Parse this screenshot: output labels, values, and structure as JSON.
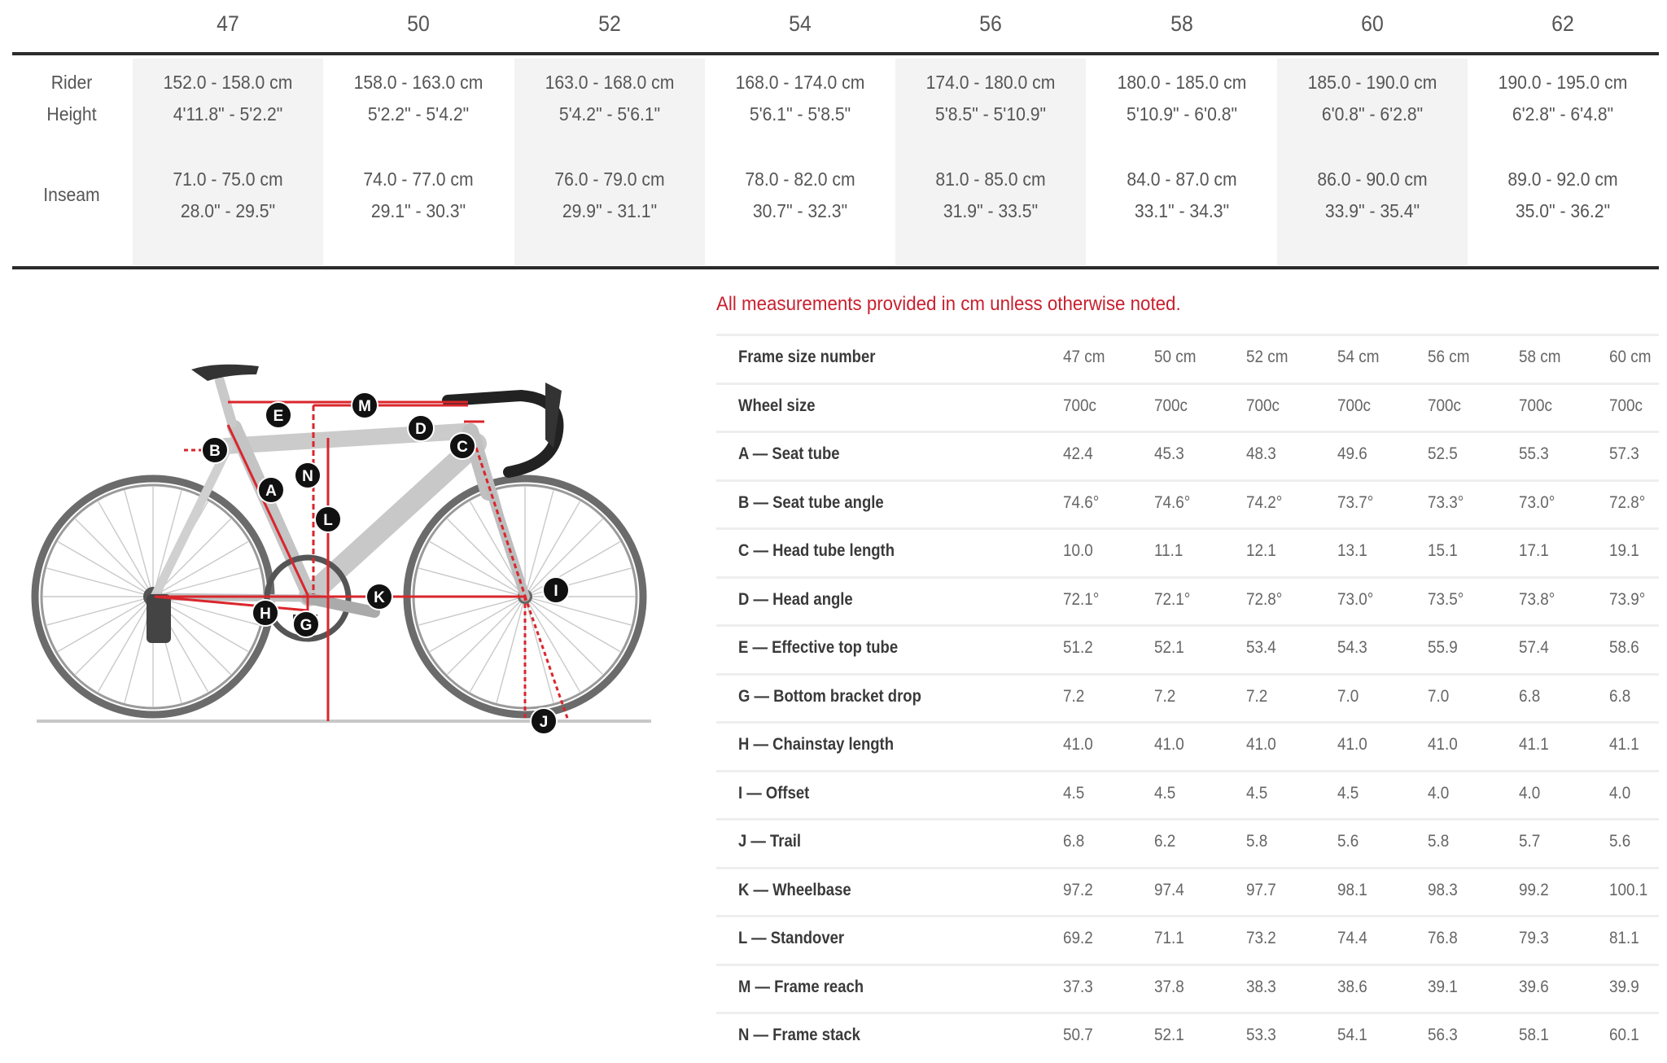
{
  "sizing": {
    "sizes": [
      "47",
      "50",
      "52",
      "54",
      "56",
      "58",
      "60",
      "62"
    ],
    "shaded_columns": [
      0,
      2,
      4,
      6
    ],
    "row_labels": {
      "rider_height": [
        "Rider",
        "Height"
      ],
      "inseam": "Inseam"
    },
    "rider_height": [
      {
        "cm": "152.0 - 158.0 cm",
        "imperial": "4'11.8\" - 5'2.2\""
      },
      {
        "cm": "158.0 - 163.0 cm",
        "imperial": "5'2.2\" - 5'4.2\""
      },
      {
        "cm": "163.0 - 168.0 cm",
        "imperial": "5'4.2\" - 5'6.1\""
      },
      {
        "cm": "168.0 - 174.0 cm",
        "imperial": "5'6.1\" - 5'8.5\""
      },
      {
        "cm": "174.0 - 180.0 cm",
        "imperial": "5'8.5\" - 5'10.9\""
      },
      {
        "cm": "180.0 - 185.0 cm",
        "imperial": "5'10.9\" - 6'0.8\""
      },
      {
        "cm": "185.0 - 190.0 cm",
        "imperial": "6'0.8\" - 6'2.8\""
      },
      {
        "cm": "190.0 - 195.0 cm",
        "imperial": "6'2.8\" - 6'4.8\""
      }
    ],
    "inseam": [
      {
        "cm": "71.0 - 75.0 cm",
        "imperial": "28.0\" - 29.5\""
      },
      {
        "cm": "74.0 - 77.0 cm",
        "imperial": "29.1\" - 30.3\""
      },
      {
        "cm": "76.0 - 79.0 cm",
        "imperial": "29.9\" - 31.1\""
      },
      {
        "cm": "78.0 - 82.0 cm",
        "imperial": "30.7\" - 32.3\""
      },
      {
        "cm": "81.0 - 85.0 cm",
        "imperial": "31.9\" - 33.5\""
      },
      {
        "cm": "84.0 - 87.0 cm",
        "imperial": "33.1\" - 34.3\""
      },
      {
        "cm": "86.0 - 90.0 cm",
        "imperial": "33.9\" - 35.4\""
      },
      {
        "cm": "89.0 - 92.0 cm",
        "imperial": "35.0\" - 36.2\""
      }
    ]
  },
  "note": "All measurements provided in cm unless otherwise noted.",
  "note_color": "#c8202f",
  "geometry": {
    "rows": [
      {
        "label": "Frame size number",
        "values": [
          "47 cm",
          "50 cm",
          "52 cm",
          "54 cm",
          "56 cm",
          "58 cm",
          "60 cm"
        ]
      },
      {
        "label": "Wheel size",
        "values": [
          "700c",
          "700c",
          "700c",
          "700c",
          "700c",
          "700c",
          "700c"
        ]
      },
      {
        "label": "A — Seat tube",
        "values": [
          "42.4",
          "45.3",
          "48.3",
          "49.6",
          "52.5",
          "55.3",
          "57.3"
        ]
      },
      {
        "label": "B — Seat tube angle",
        "values": [
          "74.6°",
          "74.6°",
          "74.2°",
          "73.7°",
          "73.3°",
          "73.0°",
          "72.8°"
        ]
      },
      {
        "label": "C — Head tube length",
        "values": [
          "10.0",
          "11.1",
          "12.1",
          "13.1",
          "15.1",
          "17.1",
          "19.1"
        ]
      },
      {
        "label": "D — Head angle",
        "values": [
          "72.1°",
          "72.1°",
          "72.8°",
          "73.0°",
          "73.5°",
          "73.8°",
          "73.9°"
        ]
      },
      {
        "label": "E — Effective top tube",
        "values": [
          "51.2",
          "52.1",
          "53.4",
          "54.3",
          "55.9",
          "57.4",
          "58.6"
        ]
      },
      {
        "label": "G — Bottom bracket drop",
        "values": [
          "7.2",
          "7.2",
          "7.2",
          "7.0",
          "7.0",
          "6.8",
          "6.8"
        ]
      },
      {
        "label": "H — Chainstay length",
        "values": [
          "41.0",
          "41.0",
          "41.0",
          "41.0",
          "41.0",
          "41.1",
          "41.1"
        ]
      },
      {
        "label": "I — Offset",
        "values": [
          "4.5",
          "4.5",
          "4.5",
          "4.5",
          "4.0",
          "4.0",
          "4.0"
        ]
      },
      {
        "label": "J — Trail",
        "values": [
          "6.8",
          "6.2",
          "5.8",
          "5.6",
          "5.8",
          "5.7",
          "5.6"
        ]
      },
      {
        "label": "K — Wheelbase",
        "values": [
          "97.2",
          "97.4",
          "97.7",
          "98.1",
          "98.3",
          "99.2",
          "100.1"
        ]
      },
      {
        "label": "L — Standover",
        "values": [
          "69.2",
          "71.1",
          "73.2",
          "74.4",
          "76.8",
          "79.3",
          "81.1"
        ]
      },
      {
        "label": "M — Frame reach",
        "values": [
          "37.3",
          "37.8",
          "38.3",
          "38.6",
          "39.1",
          "39.6",
          "39.9"
        ]
      },
      {
        "label": "N — Frame stack",
        "values": [
          "50.7",
          "52.1",
          "53.3",
          "54.1",
          "56.3",
          "58.1",
          "60.1"
        ]
      }
    ]
  },
  "diagram": {
    "badges": [
      "A",
      "B",
      "C",
      "D",
      "E",
      "G",
      "H",
      "I",
      "J",
      "K",
      "L",
      "M",
      "N"
    ],
    "measure_color": "#d9262c"
  }
}
